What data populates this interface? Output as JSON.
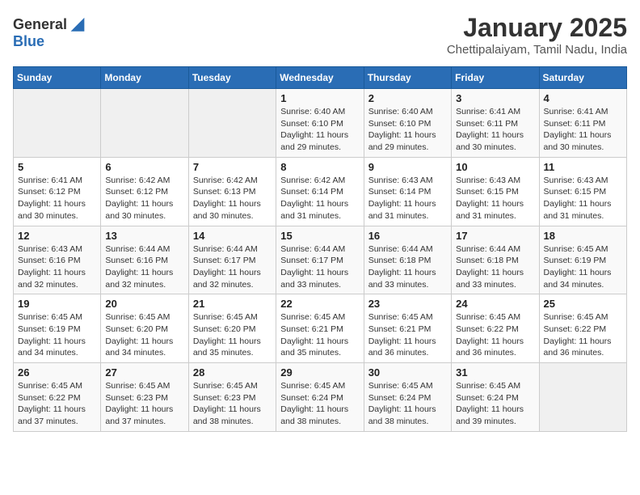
{
  "header": {
    "logo_general": "General",
    "logo_blue": "Blue",
    "title": "January 2025",
    "subtitle": "Chettipalaiyam, Tamil Nadu, India"
  },
  "calendar": {
    "days_of_week": [
      "Sunday",
      "Monday",
      "Tuesday",
      "Wednesday",
      "Thursday",
      "Friday",
      "Saturday"
    ],
    "weeks": [
      [
        {
          "day": "",
          "sunrise": "",
          "sunset": "",
          "daylight": ""
        },
        {
          "day": "",
          "sunrise": "",
          "sunset": "",
          "daylight": ""
        },
        {
          "day": "",
          "sunrise": "",
          "sunset": "",
          "daylight": ""
        },
        {
          "day": "1",
          "sunrise": "Sunrise: 6:40 AM",
          "sunset": "Sunset: 6:10 PM",
          "daylight": "Daylight: 11 hours and 29 minutes."
        },
        {
          "day": "2",
          "sunrise": "Sunrise: 6:40 AM",
          "sunset": "Sunset: 6:10 PM",
          "daylight": "Daylight: 11 hours and 29 minutes."
        },
        {
          "day": "3",
          "sunrise": "Sunrise: 6:41 AM",
          "sunset": "Sunset: 6:11 PM",
          "daylight": "Daylight: 11 hours and 30 minutes."
        },
        {
          "day": "4",
          "sunrise": "Sunrise: 6:41 AM",
          "sunset": "Sunset: 6:11 PM",
          "daylight": "Daylight: 11 hours and 30 minutes."
        }
      ],
      [
        {
          "day": "5",
          "sunrise": "Sunrise: 6:41 AM",
          "sunset": "Sunset: 6:12 PM",
          "daylight": "Daylight: 11 hours and 30 minutes."
        },
        {
          "day": "6",
          "sunrise": "Sunrise: 6:42 AM",
          "sunset": "Sunset: 6:12 PM",
          "daylight": "Daylight: 11 hours and 30 minutes."
        },
        {
          "day": "7",
          "sunrise": "Sunrise: 6:42 AM",
          "sunset": "Sunset: 6:13 PM",
          "daylight": "Daylight: 11 hours and 30 minutes."
        },
        {
          "day": "8",
          "sunrise": "Sunrise: 6:42 AM",
          "sunset": "Sunset: 6:14 PM",
          "daylight": "Daylight: 11 hours and 31 minutes."
        },
        {
          "day": "9",
          "sunrise": "Sunrise: 6:43 AM",
          "sunset": "Sunset: 6:14 PM",
          "daylight": "Daylight: 11 hours and 31 minutes."
        },
        {
          "day": "10",
          "sunrise": "Sunrise: 6:43 AM",
          "sunset": "Sunset: 6:15 PM",
          "daylight": "Daylight: 11 hours and 31 minutes."
        },
        {
          "day": "11",
          "sunrise": "Sunrise: 6:43 AM",
          "sunset": "Sunset: 6:15 PM",
          "daylight": "Daylight: 11 hours and 31 minutes."
        }
      ],
      [
        {
          "day": "12",
          "sunrise": "Sunrise: 6:43 AM",
          "sunset": "Sunset: 6:16 PM",
          "daylight": "Daylight: 11 hours and 32 minutes."
        },
        {
          "day": "13",
          "sunrise": "Sunrise: 6:44 AM",
          "sunset": "Sunset: 6:16 PM",
          "daylight": "Daylight: 11 hours and 32 minutes."
        },
        {
          "day": "14",
          "sunrise": "Sunrise: 6:44 AM",
          "sunset": "Sunset: 6:17 PM",
          "daylight": "Daylight: 11 hours and 32 minutes."
        },
        {
          "day": "15",
          "sunrise": "Sunrise: 6:44 AM",
          "sunset": "Sunset: 6:17 PM",
          "daylight": "Daylight: 11 hours and 33 minutes."
        },
        {
          "day": "16",
          "sunrise": "Sunrise: 6:44 AM",
          "sunset": "Sunset: 6:18 PM",
          "daylight": "Daylight: 11 hours and 33 minutes."
        },
        {
          "day": "17",
          "sunrise": "Sunrise: 6:44 AM",
          "sunset": "Sunset: 6:18 PM",
          "daylight": "Daylight: 11 hours and 33 minutes."
        },
        {
          "day": "18",
          "sunrise": "Sunrise: 6:45 AM",
          "sunset": "Sunset: 6:19 PM",
          "daylight": "Daylight: 11 hours and 34 minutes."
        }
      ],
      [
        {
          "day": "19",
          "sunrise": "Sunrise: 6:45 AM",
          "sunset": "Sunset: 6:19 PM",
          "daylight": "Daylight: 11 hours and 34 minutes."
        },
        {
          "day": "20",
          "sunrise": "Sunrise: 6:45 AM",
          "sunset": "Sunset: 6:20 PM",
          "daylight": "Daylight: 11 hours and 34 minutes."
        },
        {
          "day": "21",
          "sunrise": "Sunrise: 6:45 AM",
          "sunset": "Sunset: 6:20 PM",
          "daylight": "Daylight: 11 hours and 35 minutes."
        },
        {
          "day": "22",
          "sunrise": "Sunrise: 6:45 AM",
          "sunset": "Sunset: 6:21 PM",
          "daylight": "Daylight: 11 hours and 35 minutes."
        },
        {
          "day": "23",
          "sunrise": "Sunrise: 6:45 AM",
          "sunset": "Sunset: 6:21 PM",
          "daylight": "Daylight: 11 hours and 36 minutes."
        },
        {
          "day": "24",
          "sunrise": "Sunrise: 6:45 AM",
          "sunset": "Sunset: 6:22 PM",
          "daylight": "Daylight: 11 hours and 36 minutes."
        },
        {
          "day": "25",
          "sunrise": "Sunrise: 6:45 AM",
          "sunset": "Sunset: 6:22 PM",
          "daylight": "Daylight: 11 hours and 36 minutes."
        }
      ],
      [
        {
          "day": "26",
          "sunrise": "Sunrise: 6:45 AM",
          "sunset": "Sunset: 6:22 PM",
          "daylight": "Daylight: 11 hours and 37 minutes."
        },
        {
          "day": "27",
          "sunrise": "Sunrise: 6:45 AM",
          "sunset": "Sunset: 6:23 PM",
          "daylight": "Daylight: 11 hours and 37 minutes."
        },
        {
          "day": "28",
          "sunrise": "Sunrise: 6:45 AM",
          "sunset": "Sunset: 6:23 PM",
          "daylight": "Daylight: 11 hours and 38 minutes."
        },
        {
          "day": "29",
          "sunrise": "Sunrise: 6:45 AM",
          "sunset": "Sunset: 6:24 PM",
          "daylight": "Daylight: 11 hours and 38 minutes."
        },
        {
          "day": "30",
          "sunrise": "Sunrise: 6:45 AM",
          "sunset": "Sunset: 6:24 PM",
          "daylight": "Daylight: 11 hours and 38 minutes."
        },
        {
          "day": "31",
          "sunrise": "Sunrise: 6:45 AM",
          "sunset": "Sunset: 6:24 PM",
          "daylight": "Daylight: 11 hours and 39 minutes."
        },
        {
          "day": "",
          "sunrise": "",
          "sunset": "",
          "daylight": ""
        }
      ]
    ]
  }
}
